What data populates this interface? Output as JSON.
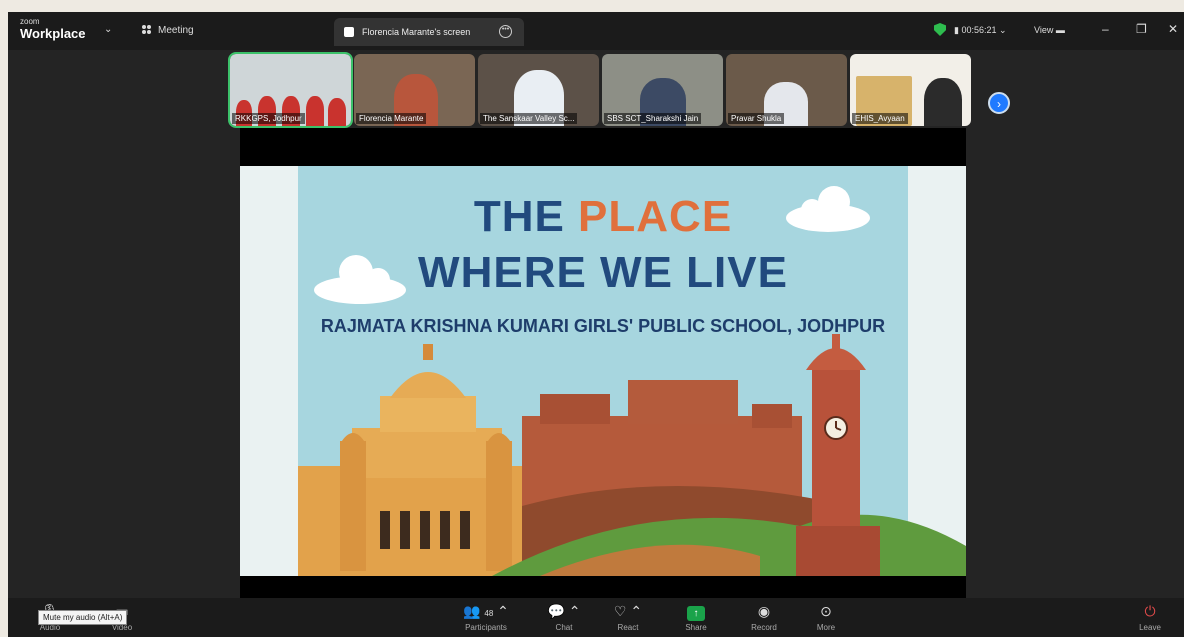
{
  "app": {
    "brand_small": "zoom",
    "brand_big": "Workplace",
    "menu_label": "Meeting"
  },
  "screen_tab": {
    "label": "Florencia Marante's screen"
  },
  "status": {
    "timer": "00:56:21",
    "view_label": "View"
  },
  "participants_strip": [
    {
      "name": "RKKGPS, Jodhpur"
    },
    {
      "name": "Florencia Marante"
    },
    {
      "name": "The Sanskaar Valley Sc..."
    },
    {
      "name": "SBS SCT_Sharakshi Jain"
    },
    {
      "name": "Pravar Shukla"
    },
    {
      "name": "EHIS_Avyaan"
    }
  ],
  "slide": {
    "title_word1": "THE",
    "title_word2": "PLACE",
    "title_line2": "WHERE WE LIVE",
    "subtitle": "RAJMATA KRISHNA KUMARI GIRLS' PUBLIC SCHOOL, JODHPUR"
  },
  "toolbar": {
    "audio": "Audio",
    "video": "Video",
    "participants": "Participants",
    "participants_count": "48",
    "chat": "Chat",
    "react": "React",
    "share": "Share",
    "record": "Record",
    "more": "More",
    "leave": "Leave"
  },
  "tooltip": {
    "text": "Mute my audio (Alt+A)"
  },
  "colors": {
    "accent_green": "#2ebd4f",
    "share_green": "#1aa34a",
    "title_blue": "#214a7e",
    "title_orange": "#e0703c"
  }
}
